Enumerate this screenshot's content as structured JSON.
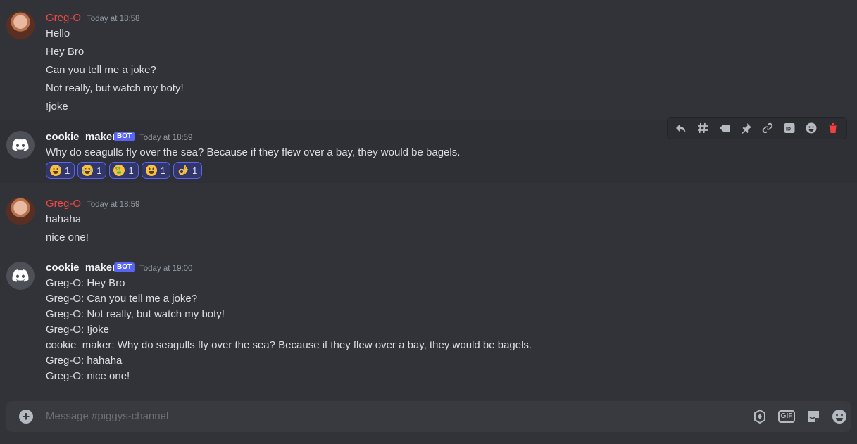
{
  "messages": [
    {
      "author": "Greg-O",
      "time": "Today at 18:58",
      "lines": [
        "Hello",
        "Hey Bro",
        "Can you tell me a joke?",
        "Not really, but watch my boty!",
        "!joke"
      ]
    },
    {
      "author": "cookie_maker",
      "badge": "BOT",
      "time": "Today at 18:59",
      "lines": [
        "Why do seagulls fly over the sea? Because if they flew over a bay, they would be bagels."
      ],
      "reactions": [
        {
          "emoji": "grinning-sweat",
          "count": "1"
        },
        {
          "emoji": "joy",
          "count": "1"
        },
        {
          "emoji": "money-mouth",
          "count": "1"
        },
        {
          "emoji": "smiley",
          "count": "1"
        },
        {
          "emoji": "ok-hand",
          "count": "1"
        }
      ]
    },
    {
      "author": "Greg-O",
      "time": "Today at 18:59",
      "lines": [
        "hahaha",
        "nice one!"
      ]
    },
    {
      "author": "cookie_maker",
      "badge": "BOT",
      "time": "Today at 19:00",
      "lines": [
        "Greg-O: Hey Bro",
        "Greg-O: Can you tell me a joke?",
        "Greg-O: Not really, but watch my boty!",
        "Greg-O: !joke",
        "cookie_maker: Why do seagulls fly over the sea? Because if they flew over a bay, they would be bagels.",
        "Greg-O: hahaha",
        "Greg-O: nice one!"
      ]
    }
  ],
  "toolbar": {
    "icons": [
      "reply-icon",
      "thread-icon",
      "tag-icon",
      "pin-icon",
      "link-icon",
      "id-icon",
      "emoji-icon",
      "delete-icon"
    ]
  },
  "composer": {
    "placeholder": "Message #piggys-channel",
    "gif_label": "GIF"
  },
  "colors": {
    "background": "#313338",
    "greg_name": "#f04747",
    "bot_badge": "#5865f2",
    "delete": "#f23f42"
  }
}
